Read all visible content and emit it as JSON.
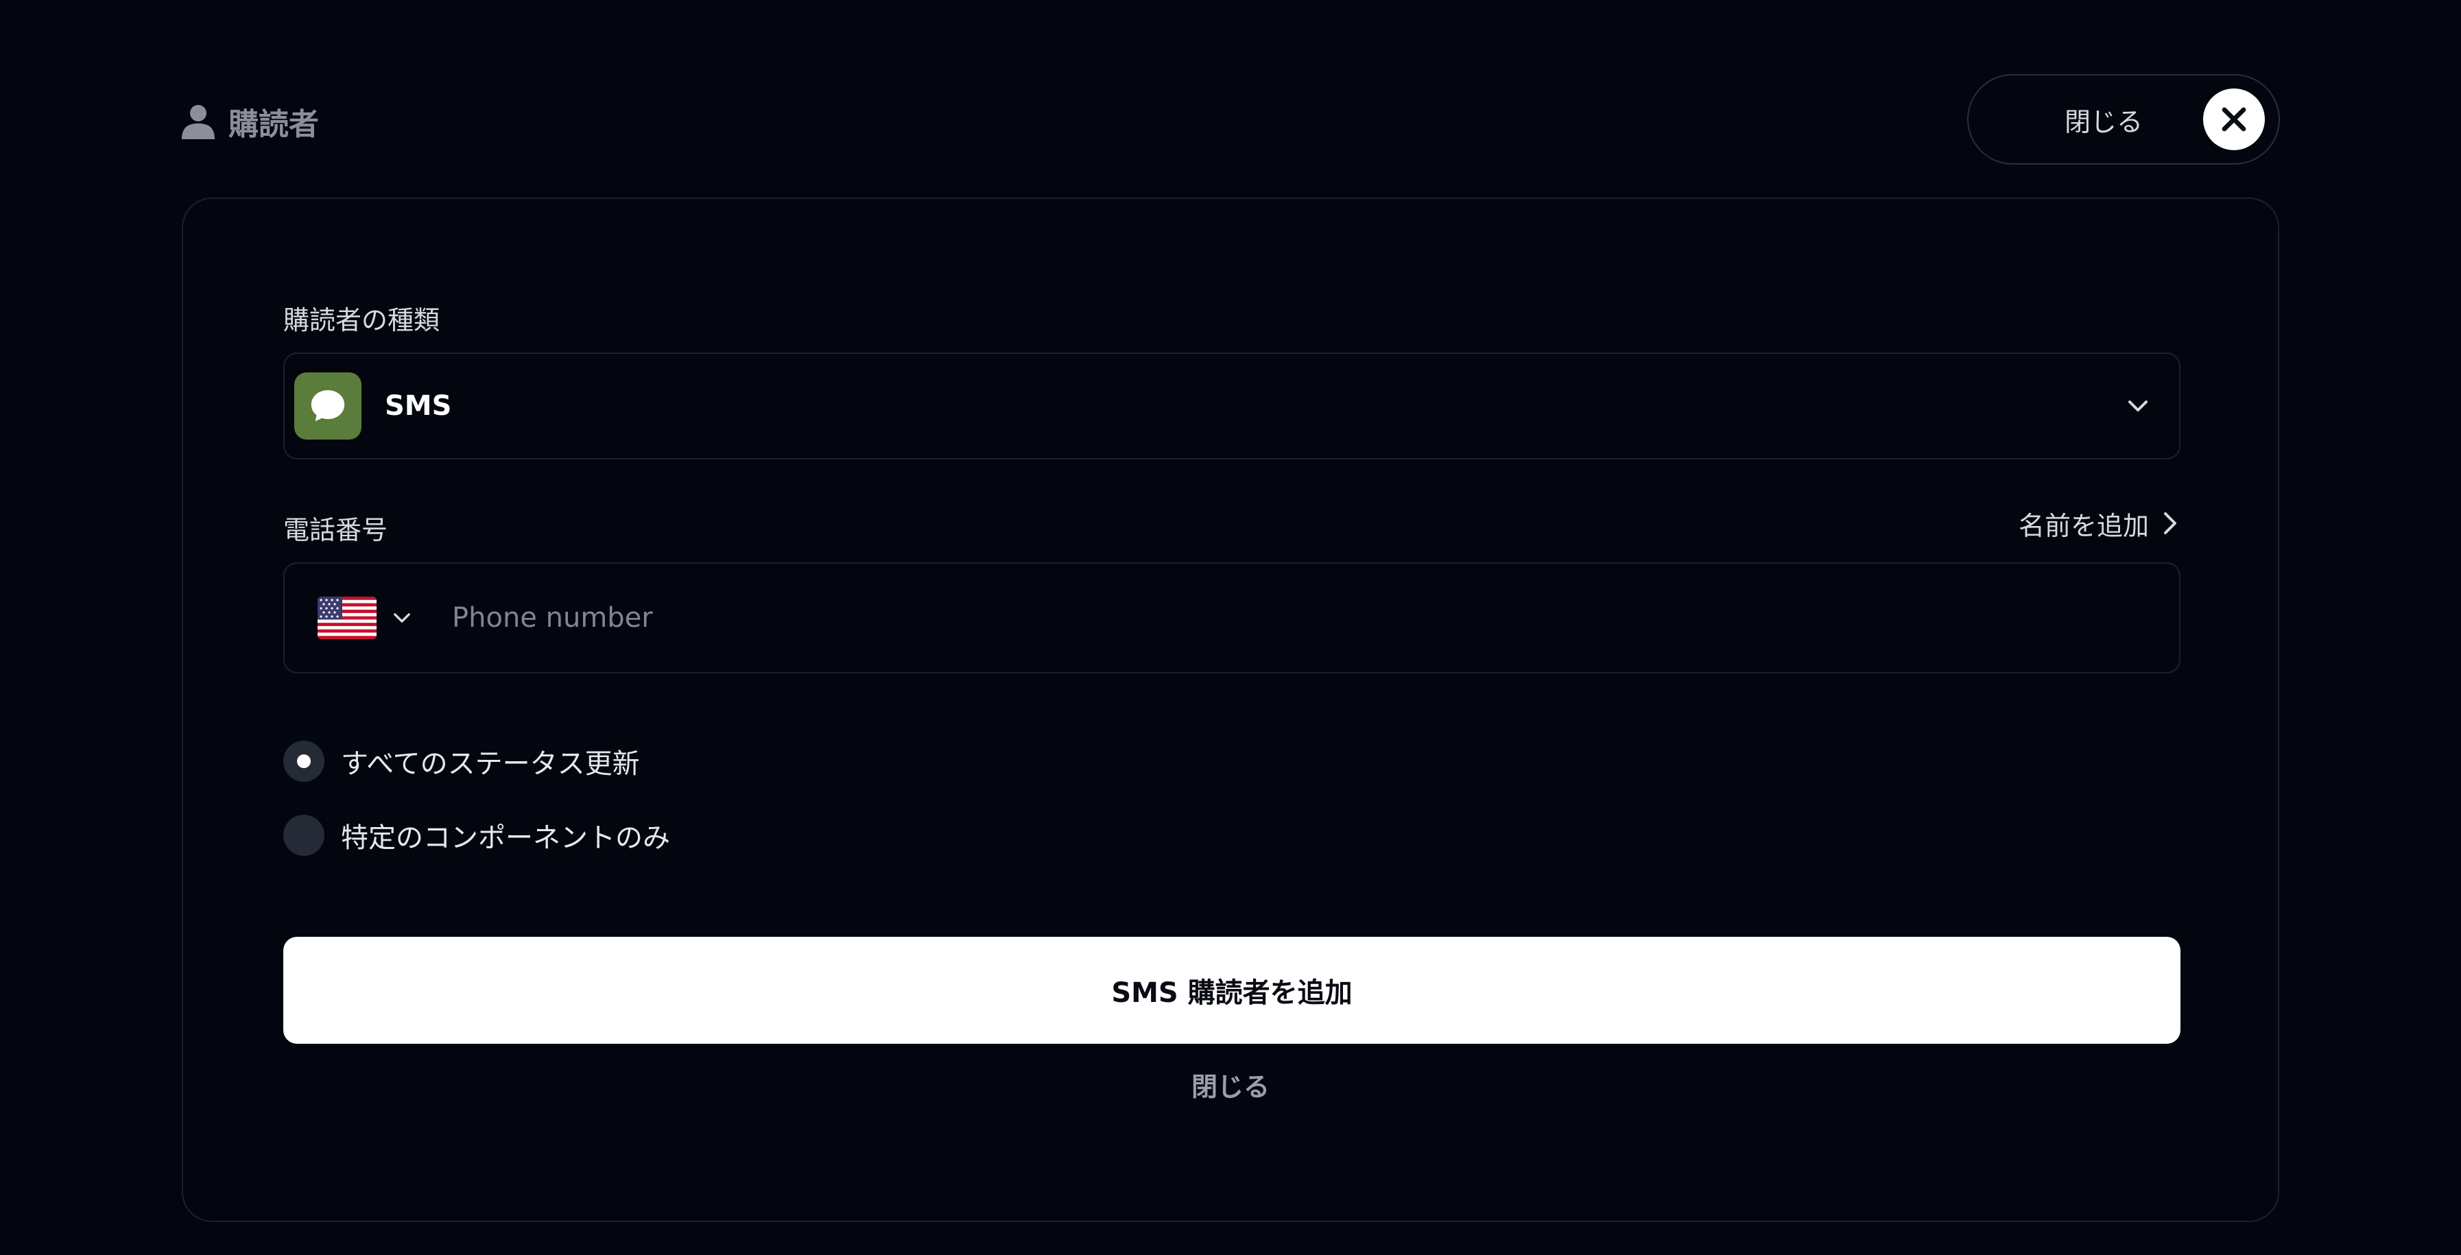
{
  "header": {
    "title": "購読者",
    "title_icon": "person-icon",
    "close_label": "閉じる",
    "close_icon": "close-x-icon"
  },
  "form": {
    "subscriber_type_label": "購読者の種類",
    "subscriber_type_value": "SMS",
    "subscriber_type_icon": "chat-bubble-icon",
    "subscriber_type_icon_color": "#5a7d3c",
    "phone_label": "電話番号",
    "add_name_link": "名前を追加",
    "country_flag": "us-flag-icon",
    "phone_placeholder": "Phone number",
    "phone_value": "",
    "options": [
      {
        "label": "すべてのステータス更新",
        "selected": true
      },
      {
        "label": "特定のコンポーネントのみ",
        "selected": false
      }
    ],
    "submit_label": "SMS 購読者を追加",
    "cancel_label": "閉じる"
  },
  "colors": {
    "background": "#04060f",
    "card_border": "#1c2030",
    "primary_button": "#ffffff"
  }
}
